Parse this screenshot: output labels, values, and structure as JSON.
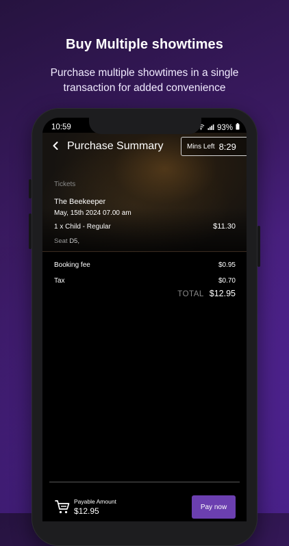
{
  "promo": {
    "headline": "Buy Multiple showtimes",
    "subline": "Purchase multiple showtimes in a single transaction for added convenience"
  },
  "status_bar": {
    "time": "10:59",
    "battery": "93%",
    "icons": [
      "alarm-icon",
      "wifi-icon",
      "signal-icon",
      "battery-icon"
    ]
  },
  "header": {
    "title": "Purchase Summary",
    "timer_label": "Mins Left",
    "timer_value": "8:29"
  },
  "tickets": {
    "section_label": "Tickets",
    "movie_title": "The Beekeeper",
    "datetime": "May, 15th 2024 07.00 am",
    "line_item": "1 x Child - Regular",
    "line_price": "$11.30",
    "seat_label": "Seat",
    "seat_value": "D5,"
  },
  "fees": [
    {
      "label": "Booking fee",
      "value": "$0.95"
    },
    {
      "label": "Tax",
      "value": "$0.70"
    }
  ],
  "total": {
    "label": "TOTAL",
    "value": "$12.95"
  },
  "footer": {
    "payable_label": "Payable Amount",
    "payable_value": "$12.95",
    "pay_button": "Pay now"
  },
  "colors": {
    "accent": "#6b3fb0",
    "background_gradient_end": "#6a2fc6"
  }
}
